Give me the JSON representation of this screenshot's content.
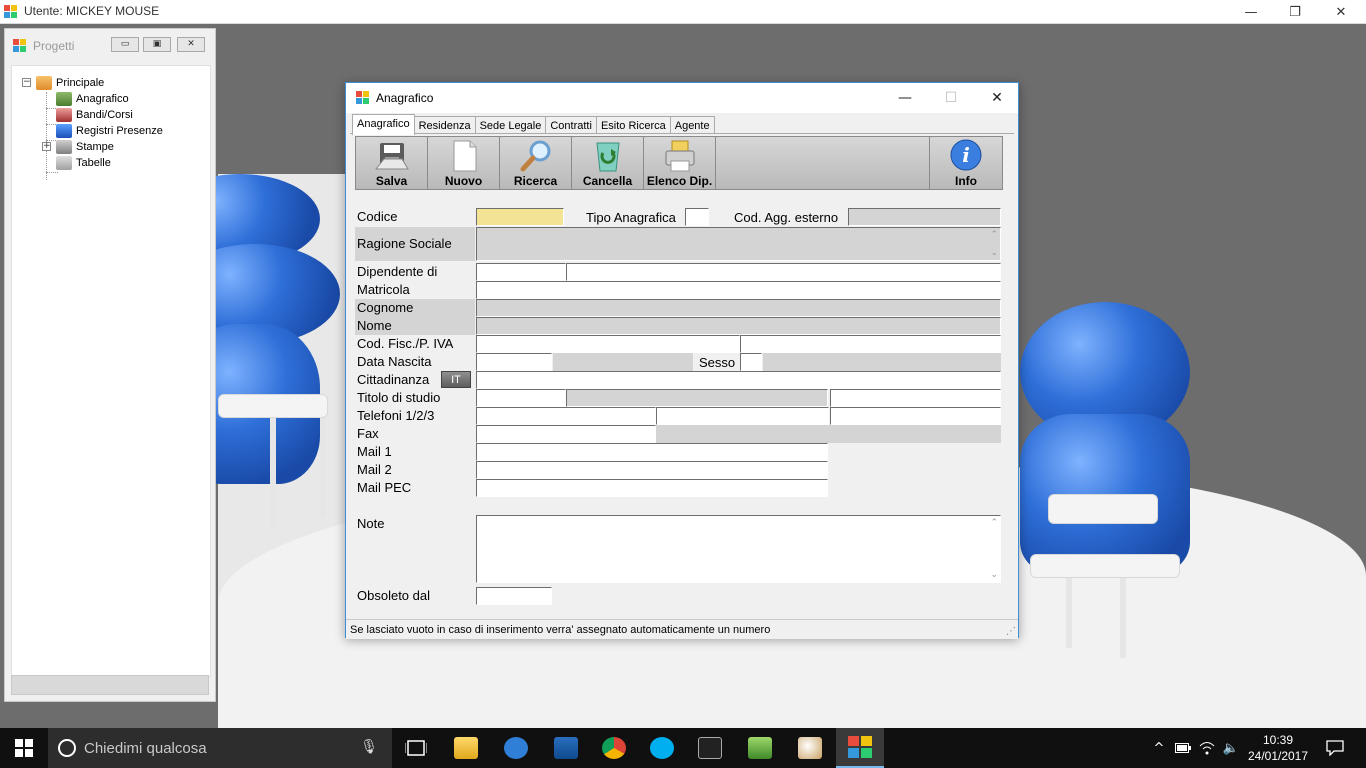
{
  "window": {
    "title": "Utente: MICKEY MOUSE",
    "minimize_glyph": "—",
    "restore_glyph": "❐",
    "close_glyph": "✕"
  },
  "project_panel": {
    "title": "Progetti",
    "buttons": {
      "minimize": "▭",
      "restore": "▣",
      "close": "✕"
    },
    "tree": {
      "root": "Principale",
      "items": [
        "Anagrafico",
        "Bandi/Corsi",
        "Registri Presenze",
        "Stampe",
        "Tabelle"
      ]
    }
  },
  "dialog": {
    "title": "Anagrafico",
    "buttons": {
      "minimize": "—",
      "maximize": "☐",
      "close": "✕"
    },
    "tabs": [
      "Anagrafico",
      "Residenza",
      "Sede Legale",
      "Contratti",
      "Esito Ricerca",
      "Agente"
    ],
    "active_tab": "Anagrafico",
    "toolbar": {
      "salva": "Salva",
      "nuovo": "Nuovo",
      "ricerca": "Ricerca",
      "cancella": "Cancella",
      "elenco_dip": "Elenco Dip.",
      "info": "Info"
    },
    "form": {
      "codice": "Codice",
      "tipo_anagrafica": "Tipo Anagrafica",
      "cod_agg_esterno": "Cod. Agg. esterno",
      "ragione_sociale": "Ragione Sociale",
      "dipendente_di": "Dipendente di",
      "matricola": "Matricola",
      "cognome": "Cognome",
      "nome": "Nome",
      "cod_fisc": "Cod. Fisc./P. IVA",
      "data_nascita": "Data Nascita",
      "sesso": "Sesso",
      "cittadinanza": "Cittadinanza",
      "cittadinanza_button": "IT",
      "titolo_di_studio": "Titolo di studio",
      "telefoni": "Telefoni 1/2/3",
      "fax": "Fax",
      "mail1": "Mail 1",
      "mail2": "Mail 2",
      "mail_pec": "Mail PEC",
      "note": "Note",
      "obsoleto_dal": "Obsoleto dal"
    },
    "status_text": "Se lasciato vuoto in caso di inserimento verra' assegnato automaticamente un numero"
  },
  "taskbar": {
    "search_placeholder": "Chiedimi qualcosa",
    "time": "10:39",
    "date": "24/01/2017"
  },
  "colors": {
    "required_field": "#f3e394",
    "disabled_field": "#d4d4d4",
    "dialog_border": "#3c8ed7",
    "desktop": "#6d6d6d"
  }
}
